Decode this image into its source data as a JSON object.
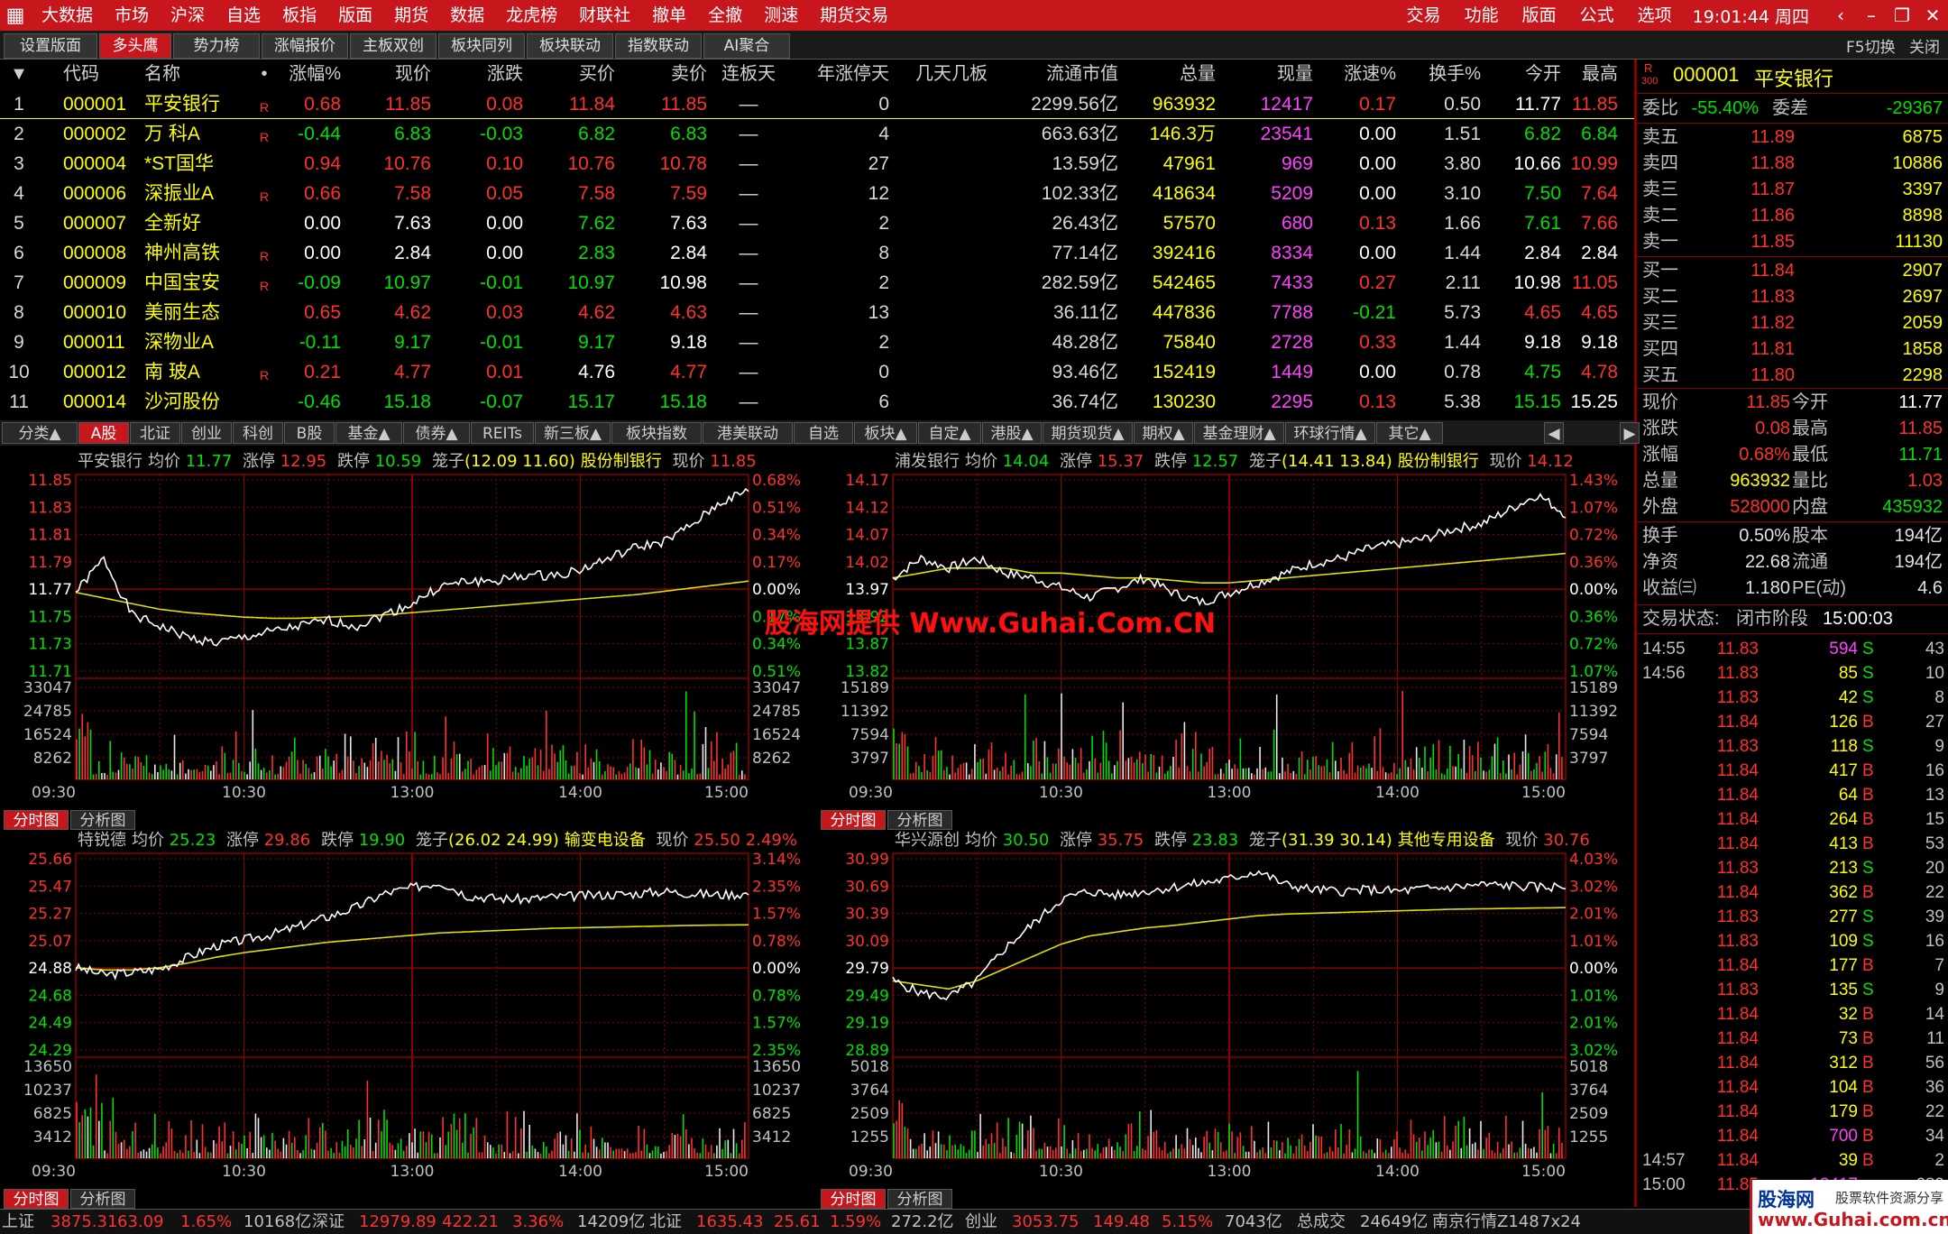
{
  "menubar": {
    "items": [
      "大数据",
      "市场",
      "沪深",
      "自选",
      "板指",
      "版面",
      "期货",
      "数据",
      "龙虎榜",
      "财联社",
      "撤单",
      "全撤",
      "测速",
      "期货交易"
    ],
    "right": [
      "交易",
      "功能",
      "版面",
      "公式",
      "选项"
    ],
    "clock": "19:01:44 周四",
    "win": [
      "‹",
      "–",
      "❐",
      "✕"
    ]
  },
  "tabbar": {
    "tabs": [
      "设置版面",
      "多头鹰",
      "势力榜",
      "涨幅报价",
      "主板双创",
      "板块同列",
      "板块联动",
      "指数联动",
      "AI聚合"
    ],
    "active": 1,
    "right": [
      "F5切换",
      "关闭"
    ]
  },
  "quote": {
    "headers": [
      "▼",
      "代码",
      "名称",
      "•",
      "涨幅%",
      "现价",
      "涨跌",
      "买价",
      "卖价",
      "连板天",
      "年涨停天",
      "几天几板",
      "流通市值",
      "总量",
      "现量",
      "涨速%",
      "换手%",
      "今开",
      "最高"
    ],
    "rows": [
      [
        "1",
        "000001",
        "平安银行",
        "R",
        "0.68",
        "11.85",
        "0.08",
        "11.84",
        "11.85",
        "—",
        "0",
        "",
        "2299.56亿",
        "963932",
        "12417",
        "0.17",
        "0.50",
        "11.77",
        "11.85"
      ],
      [
        "2",
        "000002",
        "万 科A",
        "R",
        "-0.44",
        "6.83",
        "-0.03",
        "6.82",
        "6.83",
        "—",
        "4",
        "",
        "663.63亿",
        "146.3万",
        "23541",
        "0.00",
        "1.51",
        "6.82",
        "6.84"
      ],
      [
        "3",
        "000004",
        "*ST国华",
        "",
        "0.94",
        "10.76",
        "0.10",
        "10.76",
        "10.78",
        "—",
        "27",
        "",
        "13.59亿",
        "47961",
        "969",
        "0.00",
        "3.80",
        "10.66",
        "10.99"
      ],
      [
        "4",
        "000006",
        "深振业A",
        "R",
        "0.66",
        "7.58",
        "0.05",
        "7.58",
        "7.59",
        "—",
        "12",
        "",
        "102.33亿",
        "418634",
        "5209",
        "0.00",
        "3.10",
        "7.50",
        "7.64"
      ],
      [
        "5",
        "000007",
        "全新好",
        "",
        "0.00",
        "7.63",
        "0.00",
        "7.62",
        "7.63",
        "—",
        "2",
        "",
        "26.43亿",
        "57570",
        "680",
        "0.13",
        "1.66",
        "7.61",
        "7.66"
      ],
      [
        "6",
        "000008",
        "神州高铁",
        "R",
        "0.00",
        "2.84",
        "0.00",
        "2.83",
        "2.84",
        "—",
        "8",
        "",
        "77.14亿",
        "392416",
        "8334",
        "0.00",
        "1.44",
        "2.84",
        "2.84"
      ],
      [
        "7",
        "000009",
        "中国宝安",
        "R",
        "-0.09",
        "10.97",
        "-0.01",
        "10.97",
        "10.98",
        "—",
        "2",
        "",
        "282.59亿",
        "542465",
        "7433",
        "0.27",
        "2.11",
        "10.98",
        "11.05"
      ],
      [
        "8",
        "000010",
        "美丽生态",
        "",
        "0.65",
        "4.62",
        "0.03",
        "4.62",
        "4.63",
        "—",
        "13",
        "",
        "36.11亿",
        "447836",
        "7788",
        "-0.21",
        "5.73",
        "4.65",
        "4.65"
      ],
      [
        "9",
        "000011",
        "深物业A",
        "",
        "-0.11",
        "9.17",
        "-0.01",
        "9.17",
        "9.18",
        "—",
        "2",
        "",
        "48.28亿",
        "75840",
        "2728",
        "0.33",
        "1.44",
        "9.18",
        "9.18"
      ],
      [
        "10",
        "000012",
        "南 玻A",
        "R",
        "0.21",
        "4.77",
        "0.01",
        "4.76",
        "4.77",
        "—",
        "0",
        "",
        "93.46亿",
        "152419",
        "1449",
        "0.00",
        "0.78",
        "4.75",
        "4.78"
      ],
      [
        "11",
        "000014",
        "沙河股份",
        "",
        "-0.46",
        "15.18",
        "-0.07",
        "15.17",
        "15.18",
        "—",
        "6",
        "",
        "36.74亿",
        "130230",
        "2295",
        "0.13",
        "5.38",
        "15.15",
        "15.25"
      ]
    ]
  },
  "subtabs": {
    "items": [
      "分类▲",
      "A股",
      "北证",
      "创业",
      "科创",
      "B股",
      "基金▲",
      "债券▲",
      "REITs",
      "新三板▲",
      "板块指数",
      "港美联动",
      "自选",
      "板块▲",
      "自定▲",
      "港股▲",
      "期货现货▲",
      "期权▲",
      "基金理财▲",
      "环球行情▲",
      "其它▲"
    ],
    "active": 1,
    "arrows": [
      "◀",
      "▶"
    ]
  },
  "colors": {
    "up": "#ff3030",
    "down": "#00e000",
    "flat": "#ffffff",
    "code": "#ffff00",
    "name": "#ffff00",
    "grid": "#8b0000",
    "price_line": "#ffffff",
    "avg_line": "#e0e000",
    "vol": "#e8e8e8"
  },
  "panels": [
    {
      "name": "平安银行",
      "avg": "11.77",
      "zt": "12.95",
      "dt": "10.59",
      "cage": "(12.09 11.60)",
      "ind": "股份制银行",
      "cur": "11.85",
      "prices": [
        "11.85",
        "11.83",
        "11.81",
        "11.79",
        "11.77",
        "11.75",
        "11.73",
        "11.71"
      ],
      "pcts": [
        "0.68%",
        "0.51%",
        "0.34%",
        "0.17%",
        "0.00%",
        "0.17%",
        "0.34%",
        "0.51%"
      ],
      "vols": [
        "33047",
        "24785",
        "16524",
        "8262"
      ],
      "times": [
        "09:30",
        "10:30",
        "13:00",
        "14:00",
        "15:00"
      ],
      "pmin": 11.69,
      "pmax": 11.86,
      "pre": 11.77,
      "vmax": 37000,
      "seed": 1,
      "series": [
        11.76,
        11.79,
        11.74,
        11.73,
        11.72,
        11.715,
        11.72,
        11.725,
        11.73,
        11.735,
        11.73,
        11.74,
        11.75,
        11.765,
        11.77,
        11.77,
        11.775,
        11.775,
        11.78,
        11.79,
        11.8,
        11.805,
        11.82,
        11.84,
        11.85
      ],
      "avgseries": [
        11.76,
        11.755,
        11.75,
        11.745,
        11.742,
        11.74,
        11.738,
        11.737,
        11.737,
        11.738,
        11.739,
        11.74,
        11.742,
        11.744,
        11.746,
        11.748,
        11.75,
        11.752,
        11.754,
        11.756,
        11.758,
        11.761,
        11.764,
        11.767,
        11.77
      ]
    },
    {
      "name": "浦发银行",
      "avg": "14.04",
      "zt": "15.37",
      "dt": "12.57",
      "cage": "(14.41 13.84)",
      "ind": "股份制银行",
      "cur": "14.12",
      "prices": [
        "14.17",
        "14.12",
        "14.07",
        "14.02",
        "13.97",
        "13.92",
        "13.87",
        "13.82"
      ],
      "pcts": [
        "1.43%",
        "1.07%",
        "0.72%",
        "0.36%",
        "0.00%",
        "0.36%",
        "0.72%",
        "1.07%"
      ],
      "vols": [
        "15189",
        "11392",
        "7594",
        "3797"
      ],
      "times": [
        "09:30",
        "10:30",
        "13:00",
        "14:00",
        "15:00"
      ],
      "pmin": 13.8,
      "pmax": 14.19,
      "pre": 13.97,
      "vmax": 17000,
      "seed": 7,
      "series": [
        13.99,
        14.03,
        14.01,
        14.03,
        14.0,
        13.99,
        13.97,
        13.95,
        13.97,
        13.99,
        13.96,
        13.94,
        13.96,
        13.98,
        14.0,
        14.02,
        14.03,
        14.05,
        14.06,
        14.07,
        14.09,
        14.1,
        14.13,
        14.16,
        14.12
      ],
      "avgseries": [
        13.99,
        14.0,
        14.01,
        14.01,
        14.01,
        14.0,
        14.0,
        13.995,
        13.99,
        13.99,
        13.985,
        13.98,
        13.98,
        13.985,
        13.99,
        13.995,
        14.0,
        14.005,
        14.01,
        14.015,
        14.02,
        14.025,
        14.03,
        14.035,
        14.04
      ]
    },
    {
      "name": "特锐德",
      "avg": "25.23",
      "zt": "29.86",
      "dt": "19.90",
      "cage": "(26.02 24.99)",
      "ind": "输变电设备",
      "cur": "25.50",
      "pct": "2.49%",
      "prices": [
        "25.66",
        "25.47",
        "25.27",
        "25.07",
        "24.88",
        "24.68",
        "24.49",
        "24.29"
      ],
      "pcts": [
        "3.14%",
        "2.35%",
        "1.57%",
        "0.78%",
        "0.00%",
        "0.78%",
        "1.57%",
        "2.35%"
      ],
      "vols": [
        "13650",
        "10237",
        "6825",
        "3412"
      ],
      "times": [
        "09:30",
        "10:30",
        "13:00",
        "14:00",
        "15:00"
      ],
      "pmin": 24.15,
      "pmax": 25.8,
      "pre": 24.88,
      "vmax": 15000,
      "seed": 3,
      "series": [
        24.86,
        24.8,
        24.82,
        24.85,
        24.95,
        25.05,
        25.1,
        25.15,
        25.22,
        25.3,
        25.38,
        25.5,
        25.55,
        25.6,
        25.48,
        25.46,
        25.45,
        25.47,
        25.48,
        25.49,
        25.5,
        25.52,
        25.5,
        25.49,
        25.5
      ],
      "avgseries": [
        24.86,
        24.84,
        24.84,
        24.86,
        24.9,
        24.95,
        24.99,
        25.02,
        25.05,
        25.08,
        25.1,
        25.12,
        25.14,
        25.16,
        25.17,
        25.18,
        25.19,
        25.2,
        25.205,
        25.21,
        25.215,
        25.22,
        25.225,
        25.228,
        25.23
      ]
    },
    {
      "name": "华兴源创",
      "avg": "30.50",
      "zt": "35.75",
      "dt": "23.83",
      "cage": "(31.39 30.14)",
      "ind": "其他专用设备",
      "cur": "30.76",
      "prices": [
        "30.99",
        "30.69",
        "30.39",
        "30.09",
        "29.79",
        "29.49",
        "29.19",
        "28.89"
      ],
      "pcts": [
        "4.03%",
        "3.02%",
        "2.01%",
        "1.01%",
        "0.00%",
        "1.01%",
        "2.01%",
        "3.02%"
      ],
      "vols": [
        "5018",
        "3764",
        "2509",
        "1255"
      ],
      "times": [
        "09:30",
        "10:30",
        "13:00",
        "14:00",
        "15:00"
      ],
      "pmin": 28.75,
      "pmax": 31.1,
      "pre": 29.79,
      "vmax": 5500,
      "seed": 5,
      "series": [
        29.6,
        29.45,
        29.4,
        29.6,
        30.0,
        30.3,
        30.6,
        30.7,
        30.65,
        30.7,
        30.75,
        30.8,
        30.85,
        30.95,
        30.78,
        30.72,
        30.7,
        30.72,
        30.7,
        30.73,
        30.75,
        30.78,
        30.77,
        30.75,
        30.76
      ],
      "avgseries": [
        29.6,
        29.55,
        29.5,
        29.6,
        29.75,
        29.9,
        30.05,
        30.15,
        30.2,
        30.25,
        30.28,
        30.32,
        30.36,
        30.4,
        30.42,
        30.43,
        30.44,
        30.45,
        30.46,
        30.47,
        30.48,
        30.485,
        30.49,
        30.495,
        30.5
      ]
    }
  ],
  "ptabs": [
    "分时图",
    "分析图"
  ],
  "side": {
    "code": "000001",
    "name": "平安银行",
    "badge": "R",
    "badge2": "300",
    "wb": {
      "l1": "委比",
      "v1": "-55.40%",
      "l2": "委差",
      "v2": "-29367"
    },
    "sells": [
      [
        "卖五",
        "11.89",
        "6875"
      ],
      [
        "卖四",
        "11.88",
        "10886"
      ],
      [
        "卖三",
        "11.87",
        "3397"
      ],
      [
        "卖二",
        "11.86",
        "8898"
      ],
      [
        "卖一",
        "11.85",
        "11130"
      ]
    ],
    "buys": [
      [
        "买一",
        "11.84",
        "2907"
      ],
      [
        "买二",
        "11.83",
        "2697"
      ],
      [
        "买三",
        "11.82",
        "2059"
      ],
      [
        "买四",
        "11.81",
        "1858"
      ],
      [
        "买五",
        "11.80",
        "2298"
      ]
    ],
    "stats": [
      [
        "现价",
        "11.85",
        "今开",
        "11.77"
      ],
      [
        "涨跌",
        "0.08",
        "最高",
        "11.85"
      ],
      [
        "涨幅",
        "0.68%",
        "最低",
        "11.71"
      ],
      [
        "总量",
        "963932",
        "量比",
        "1.03"
      ],
      [
        "外盘",
        "528000",
        "内盘",
        "435932"
      ]
    ],
    "stats2": [
      [
        "换手",
        "0.50%",
        "股本",
        "194亿"
      ],
      [
        "净资",
        "22.68",
        "流通",
        "194亿"
      ],
      [
        "收益㈢",
        "1.180",
        "PE(动)",
        "4.6"
      ]
    ],
    "trade_state_label": "交易状态:",
    "trade_state": "闭市阶段",
    "trade_time": "15:00:03",
    "ticks": [
      [
        "14:55",
        "11.83",
        "594",
        "S",
        "43"
      ],
      [
        "14:56",
        "11.83",
        "85",
        "S",
        "10"
      ],
      [
        "",
        "11.83",
        "42",
        "S",
        "8"
      ],
      [
        "",
        "11.84",
        "126",
        "B",
        "27"
      ],
      [
        "",
        "11.83",
        "118",
        "S",
        "9"
      ],
      [
        "",
        "11.84",
        "417",
        "B",
        "16"
      ],
      [
        "",
        "11.84",
        "64",
        "B",
        "13"
      ],
      [
        "",
        "11.84",
        "264",
        "B",
        "15"
      ],
      [
        "",
        "11.84",
        "413",
        "B",
        "53"
      ],
      [
        "",
        "11.83",
        "213",
        "S",
        "20"
      ],
      [
        "",
        "11.84",
        "362",
        "B",
        "22"
      ],
      [
        "",
        "11.83",
        "277",
        "S",
        "39"
      ],
      [
        "",
        "11.83",
        "109",
        "S",
        "16"
      ],
      [
        "",
        "11.84",
        "177",
        "B",
        "7"
      ],
      [
        "",
        "11.83",
        "135",
        "S",
        "9"
      ],
      [
        "",
        "11.84",
        "32",
        "B",
        "14"
      ],
      [
        "",
        "11.84",
        "73",
        "B",
        "11"
      ],
      [
        "",
        "11.84",
        "312",
        "B",
        "56"
      ],
      [
        "",
        "11.84",
        "104",
        "B",
        "36"
      ],
      [
        "",
        "11.84",
        "179",
        "B",
        "22"
      ],
      [
        "",
        "11.84",
        "700",
        "B",
        "34"
      ],
      [
        "14:57",
        "11.84",
        "39",
        "B",
        "2"
      ],
      [
        "15:00",
        "11.85",
        "12417",
        "",
        "689"
      ]
    ]
  },
  "statusbar": [
    [
      "上证",
      "#c0c0c0"
    ],
    [
      "3875.31",
      "#ff3030"
    ],
    [
      "63.09",
      "#ff3030"
    ],
    [
      "1.65%",
      "#ff3030"
    ],
    [
      "10168亿",
      "#c0c0c0"
    ],
    [
      "深证",
      "#c0c0c0"
    ],
    [
      "12979.89",
      "#ff3030"
    ],
    [
      "422.21",
      "#ff3030"
    ],
    [
      "3.36%",
      "#ff3030"
    ],
    [
      "14209亿",
      "#c0c0c0"
    ],
    [
      "北证",
      "#c0c0c0"
    ],
    [
      "1635.43",
      "#ff3030"
    ],
    [
      "25.61",
      "#ff3030"
    ],
    [
      "1.59%",
      "#ff3030"
    ],
    [
      "272.2亿",
      "#c0c0c0"
    ],
    [
      "创业",
      "#c0c0c0"
    ],
    [
      "3053.75",
      "#ff3030"
    ],
    [
      "149.48",
      "#ff3030"
    ],
    [
      "5.15%",
      "#ff3030"
    ],
    [
      "7043亿",
      "#c0c0c0"
    ],
    [
      "总成交",
      "#c0c0c0"
    ],
    [
      "24649亿",
      "#c0c0c0"
    ],
    [
      "南京行情Z148",
      "#c0c0c0"
    ],
    [
      "7x24",
      "#c0c0c0"
    ]
  ],
  "brand": {
    "b1": "股海网",
    "b2": "股票软件资源分享",
    "b3": "www.Guhai.com.cn"
  },
  "watermark": "股海网提供 Www.Guhai.Com.CN"
}
